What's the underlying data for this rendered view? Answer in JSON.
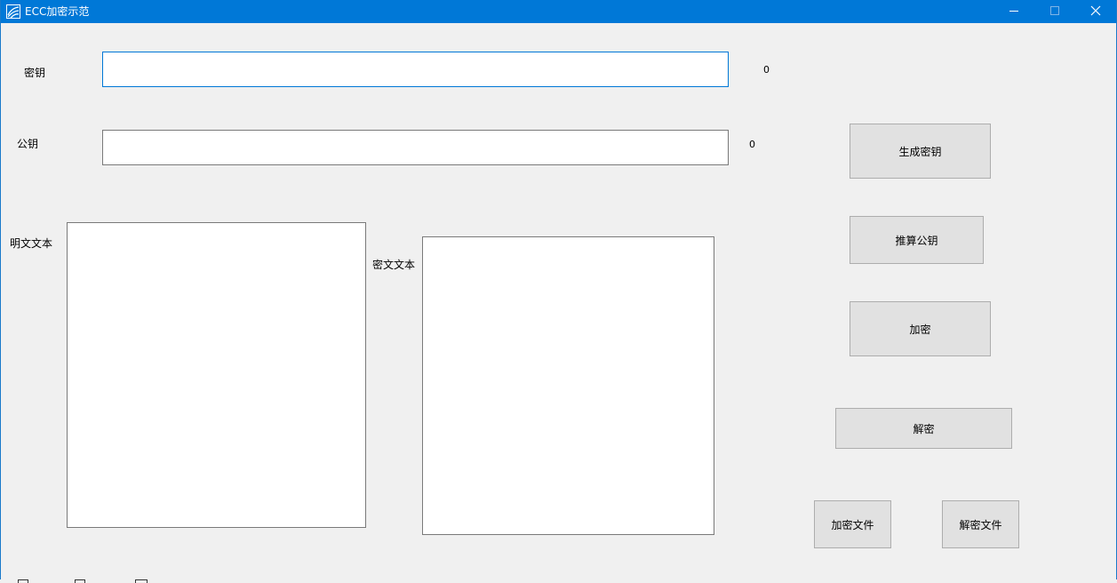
{
  "window": {
    "title": "ECC加密示范",
    "app_icon": "app-logo-icon",
    "controls": {
      "minimize_icon": "minimize-icon",
      "maximize_icon": "maximize-icon",
      "close_icon": "close-icon"
    },
    "accent_color": "#0078d7"
  },
  "form": {
    "private_key": {
      "label": "密钥",
      "value": "",
      "length": "0"
    },
    "public_key": {
      "label": "公钥",
      "value": "",
      "length": "0"
    },
    "plaintext": {
      "label": "明文文本",
      "value": ""
    },
    "ciphertext": {
      "label": "密文文本",
      "value": ""
    }
  },
  "buttons": {
    "generate_key": "生成密钥",
    "derive_public_key": "推算公钥",
    "encrypt": "加密",
    "decrypt": "解密",
    "encrypt_file": "加密文件",
    "decrypt_file": "解密文件"
  }
}
